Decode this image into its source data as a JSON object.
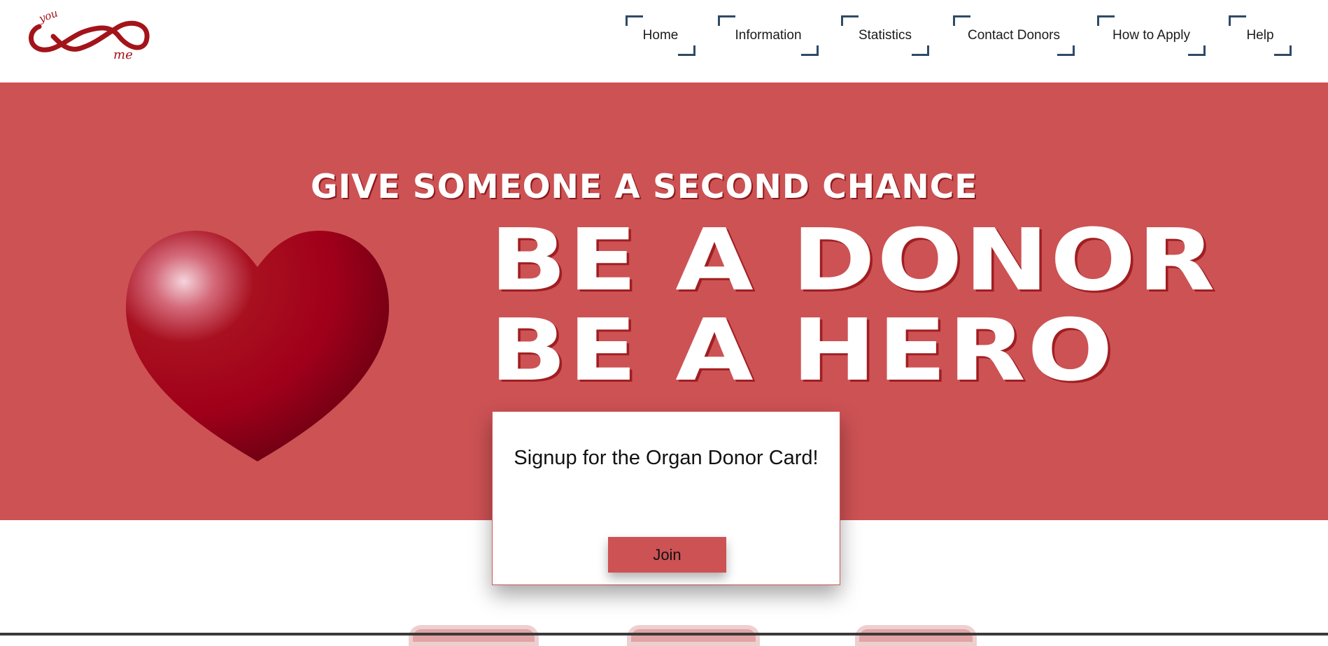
{
  "logo": {
    "alt": "you & me infinity logo",
    "word_top": "you",
    "word_bottom": "me",
    "color": "#a3141a"
  },
  "nav": {
    "items": [
      {
        "label": "Home"
      },
      {
        "label": "Information"
      },
      {
        "label": "Statistics"
      },
      {
        "label": "Contact Donors"
      },
      {
        "label": "How to Apply"
      },
      {
        "label": "Help"
      }
    ],
    "corner_color": "#2e4a66"
  },
  "hero": {
    "tagline": "GIVE SOMEONE A SECOND CHANCE",
    "headline_1": "BE A DONOR",
    "headline_2": "BE A HERO",
    "background": "#cd5254",
    "heart_icon": "heart-icon"
  },
  "signup": {
    "title": "Signup for the Organ Donor Card!",
    "button_label": "Join"
  },
  "colors": {
    "accent": "#cd5254",
    "nav_corner": "#2e4a66"
  }
}
